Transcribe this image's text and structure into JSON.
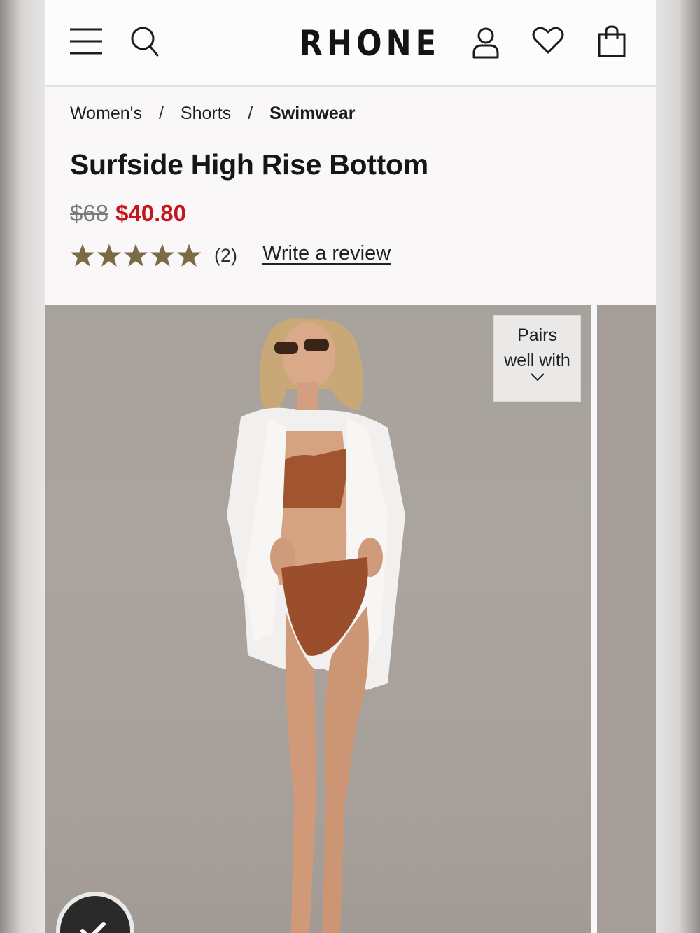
{
  "header": {
    "logo": "RHONE",
    "icons": [
      "menu-icon",
      "search-icon",
      "account-icon",
      "heart-icon",
      "bag-icon"
    ]
  },
  "breadcrumb": {
    "items": [
      "Women's",
      "Shorts",
      "Swimwear"
    ],
    "separator": "/"
  },
  "product": {
    "title": "Surfside High Rise Bottom",
    "original_price": "$68",
    "sale_price": "$40.80",
    "rating_stars": 5,
    "review_count": "(2)",
    "write_review_label": "Write a review"
  },
  "gallery": {
    "pairs_label_line1": "Pairs",
    "pairs_label_line2": "well with"
  },
  "colors": {
    "sale": "#c4161c",
    "star": "#7a6a45",
    "text": "#161616"
  }
}
